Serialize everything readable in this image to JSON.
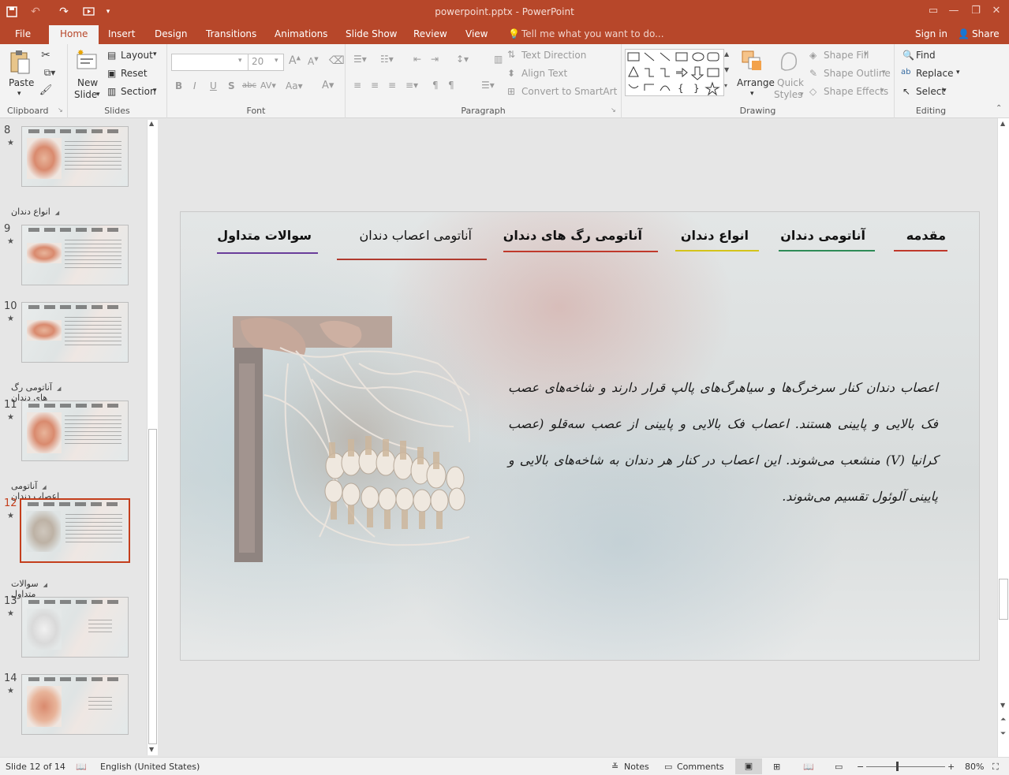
{
  "app": {
    "title": "powerpoint.pptx - PowerPoint"
  },
  "tabs": [
    {
      "label": "File"
    },
    {
      "label": "Home"
    },
    {
      "label": "Insert"
    },
    {
      "label": "Design"
    },
    {
      "label": "Transitions"
    },
    {
      "label": "Animations"
    },
    {
      "label": "Slide Show"
    },
    {
      "label": "Review"
    },
    {
      "label": "View"
    }
  ],
  "tell_me": "Tell me what you want to do...",
  "sign_in": "Sign in",
  "share": "Share",
  "ribbon": {
    "clipboard": {
      "label": "Clipboard",
      "paste": "Paste"
    },
    "slides": {
      "label": "Slides",
      "new_slide_1": "New",
      "new_slide_2": "Slide",
      "layout": "Layout",
      "reset": "Reset",
      "section": "Section"
    },
    "font": {
      "label": "Font",
      "size": "20"
    },
    "paragraph": {
      "label": "Paragraph",
      "text_direction": "Text Direction",
      "align_text": "Align Text",
      "convert_smartart": "Convert to SmartArt"
    },
    "drawing": {
      "label": "Drawing",
      "arrange": "Arrange",
      "quick_styles_1": "Quick",
      "quick_styles_2": "Styles",
      "shape_fill": "Shape Fill",
      "shape_outline": "Shape Outline",
      "shape_effects": "Shape Effects"
    },
    "editing": {
      "label": "Editing",
      "find": "Find",
      "replace": "Replace",
      "select": "Select"
    }
  },
  "thumbnails": [
    {
      "num": "8"
    },
    {
      "num": "9"
    },
    {
      "num": "10"
    },
    {
      "num": "11"
    },
    {
      "num": "12"
    },
    {
      "num": "13"
    },
    {
      "num": "14"
    }
  ],
  "sections": [
    "انواع دندان",
    "آناتومی رگ های دندان",
    "آناتومی اعصاب دندان",
    "سوالات متداول"
  ],
  "slide": {
    "nav": [
      "مقدمه",
      "آناتومی دندان",
      "انواع دندان",
      "آناتومی رگ های دندان",
      "آناتومی اعصاب دندان",
      "سوالات متداول"
    ],
    "colors": {
      "mqaddame": "#c0392b",
      "anatomy": "#2e8b57",
      "types": "#d4c41a",
      "vessels": "#c0392b",
      "nerves": "#b03a2e",
      "faq": "#6a3d9a"
    },
    "paragraph": "اعصاب دندان کنار سرخرگ‌ها و سیاهرگ‌های پالپ قرار دارند و شاخه‌های عصب فک بالایی و پایینی هستند. اعصاب فک بالایی و پایینی از عصب سه‌قلو (عصب کرانیا (V) منشعب می‌شوند. این اعصاب در کنار هر دندان به شاخه‌های بالایی و پایینی آلوئول تقسیم می‌شوند."
  },
  "status": {
    "slide": "Slide 12 of 14",
    "language": "English (United States)",
    "notes": "Notes",
    "comments": "Comments",
    "zoom": "80%"
  }
}
